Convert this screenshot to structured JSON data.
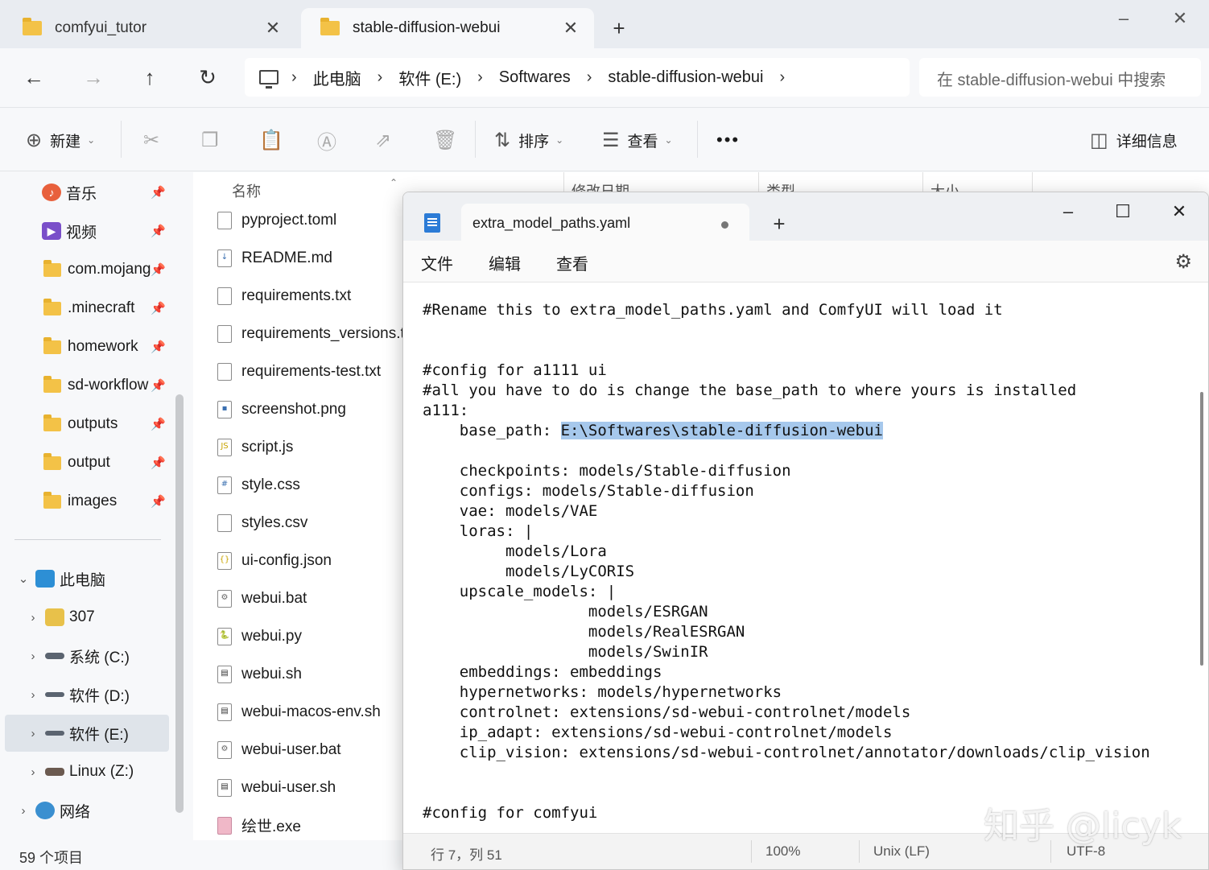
{
  "explorer": {
    "tabs": [
      {
        "label": "comfyui_tutor",
        "icon": "folder-icon"
      },
      {
        "label": "stable-diffusion-webui",
        "icon": "folder-icon"
      }
    ],
    "breadcrumb": [
      "此电脑",
      "软件 (E:)",
      "Softwares",
      "stable-diffusion-webui"
    ],
    "search_placeholder": "在 stable-diffusion-webui 中搜索",
    "toolbar": {
      "new_label": "新建",
      "sort_label": "排序",
      "view_label": "查看",
      "more_label": "•••",
      "details_label": "详细信息"
    },
    "sidebar": {
      "quick_access": [
        {
          "label": "音乐",
          "icon": "music-icon",
          "color": "#e8603c"
        },
        {
          "label": "视频",
          "icon": "video-icon",
          "color": "#7a4fc9"
        },
        {
          "label": "com.mojang",
          "icon": "folder-icon"
        },
        {
          "label": ".minecraft",
          "icon": "folder-icon"
        },
        {
          "label": "homework",
          "icon": "folder-icon"
        },
        {
          "label": "sd-workflow",
          "icon": "folder-icon"
        },
        {
          "label": "outputs",
          "icon": "folder-icon"
        },
        {
          "label": "output",
          "icon": "folder-icon"
        },
        {
          "label": "images",
          "icon": "folder-icon"
        }
      ],
      "this_pc_label": "此电脑",
      "drives": [
        {
          "label": "307"
        },
        {
          "label": "系统 (C:)"
        },
        {
          "label": "软件 (D:)"
        },
        {
          "label": "软件 (E:)",
          "selected": true
        },
        {
          "label": "Linux (Z:)"
        }
      ],
      "network_label": "网络"
    },
    "columns": [
      "名称",
      "修改日期",
      "类型",
      "大小"
    ],
    "files": [
      {
        "name": "pyproject.toml",
        "icon": "text-file-icon"
      },
      {
        "name": "README.md",
        "icon": "markdown-file-icon"
      },
      {
        "name": "requirements.txt",
        "icon": "text-file-icon"
      },
      {
        "name": "requirements_versions.txt",
        "icon": "text-file-icon"
      },
      {
        "name": "requirements-test.txt",
        "icon": "text-file-icon"
      },
      {
        "name": "screenshot.png",
        "icon": "image-file-icon"
      },
      {
        "name": "script.js",
        "icon": "js-file-icon"
      },
      {
        "name": "style.css",
        "icon": "css-file-icon"
      },
      {
        "name": "styles.csv",
        "icon": "text-file-icon"
      },
      {
        "name": "ui-config.json",
        "icon": "json-file-icon"
      },
      {
        "name": "webui.bat",
        "icon": "bat-file-icon"
      },
      {
        "name": "webui.py",
        "icon": "python-file-icon"
      },
      {
        "name": "webui.sh",
        "icon": "shell-file-icon"
      },
      {
        "name": "webui-macos-env.sh",
        "icon": "shell-file-icon"
      },
      {
        "name": "webui-user.bat",
        "icon": "bat-file-icon"
      },
      {
        "name": "webui-user.sh",
        "icon": "shell-file-icon"
      },
      {
        "name": "绘世.exe",
        "icon": "exe-file-icon"
      }
    ],
    "item_count": "59 个项目"
  },
  "notepad": {
    "tab_title": "extra_model_paths.yaml",
    "menu": [
      "文件",
      "编辑",
      "查看"
    ],
    "code_before_selection": "#Rename this to extra_model_paths.yaml and ComfyUI will load it\n\n\n#config for a1111 ui\n#all you have to do is change the base_path to where yours is installed\na111:\n    base_path: ",
    "selected_text": "E:\\Softwares\\stable-diffusion-webui",
    "code_after_selection": "\n\n    checkpoints: models/Stable-diffusion\n    configs: models/Stable-diffusion\n    vae: models/VAE\n    loras: |\n         models/Lora\n         models/LyCORIS\n    upscale_models: |\n                  models/ESRGAN\n                  models/RealESRGAN\n                  models/SwinIR\n    embeddings: embeddings\n    hypernetworks: models/hypernetworks\n    controlnet: extensions/sd-webui-controlnet/models\n    ip_adapt: extensions/sd-webui-controlnet/models\n    clip_vision: extensions/sd-webui-controlnet/annotator/downloads/clip_vision\n\n\n#config for comfyui",
    "status": {
      "position": "行 7，列 51",
      "zoom": "100%",
      "line_ending": "Unix (LF)",
      "encoding": "UTF-8"
    }
  },
  "watermark": "知乎 @licyk"
}
